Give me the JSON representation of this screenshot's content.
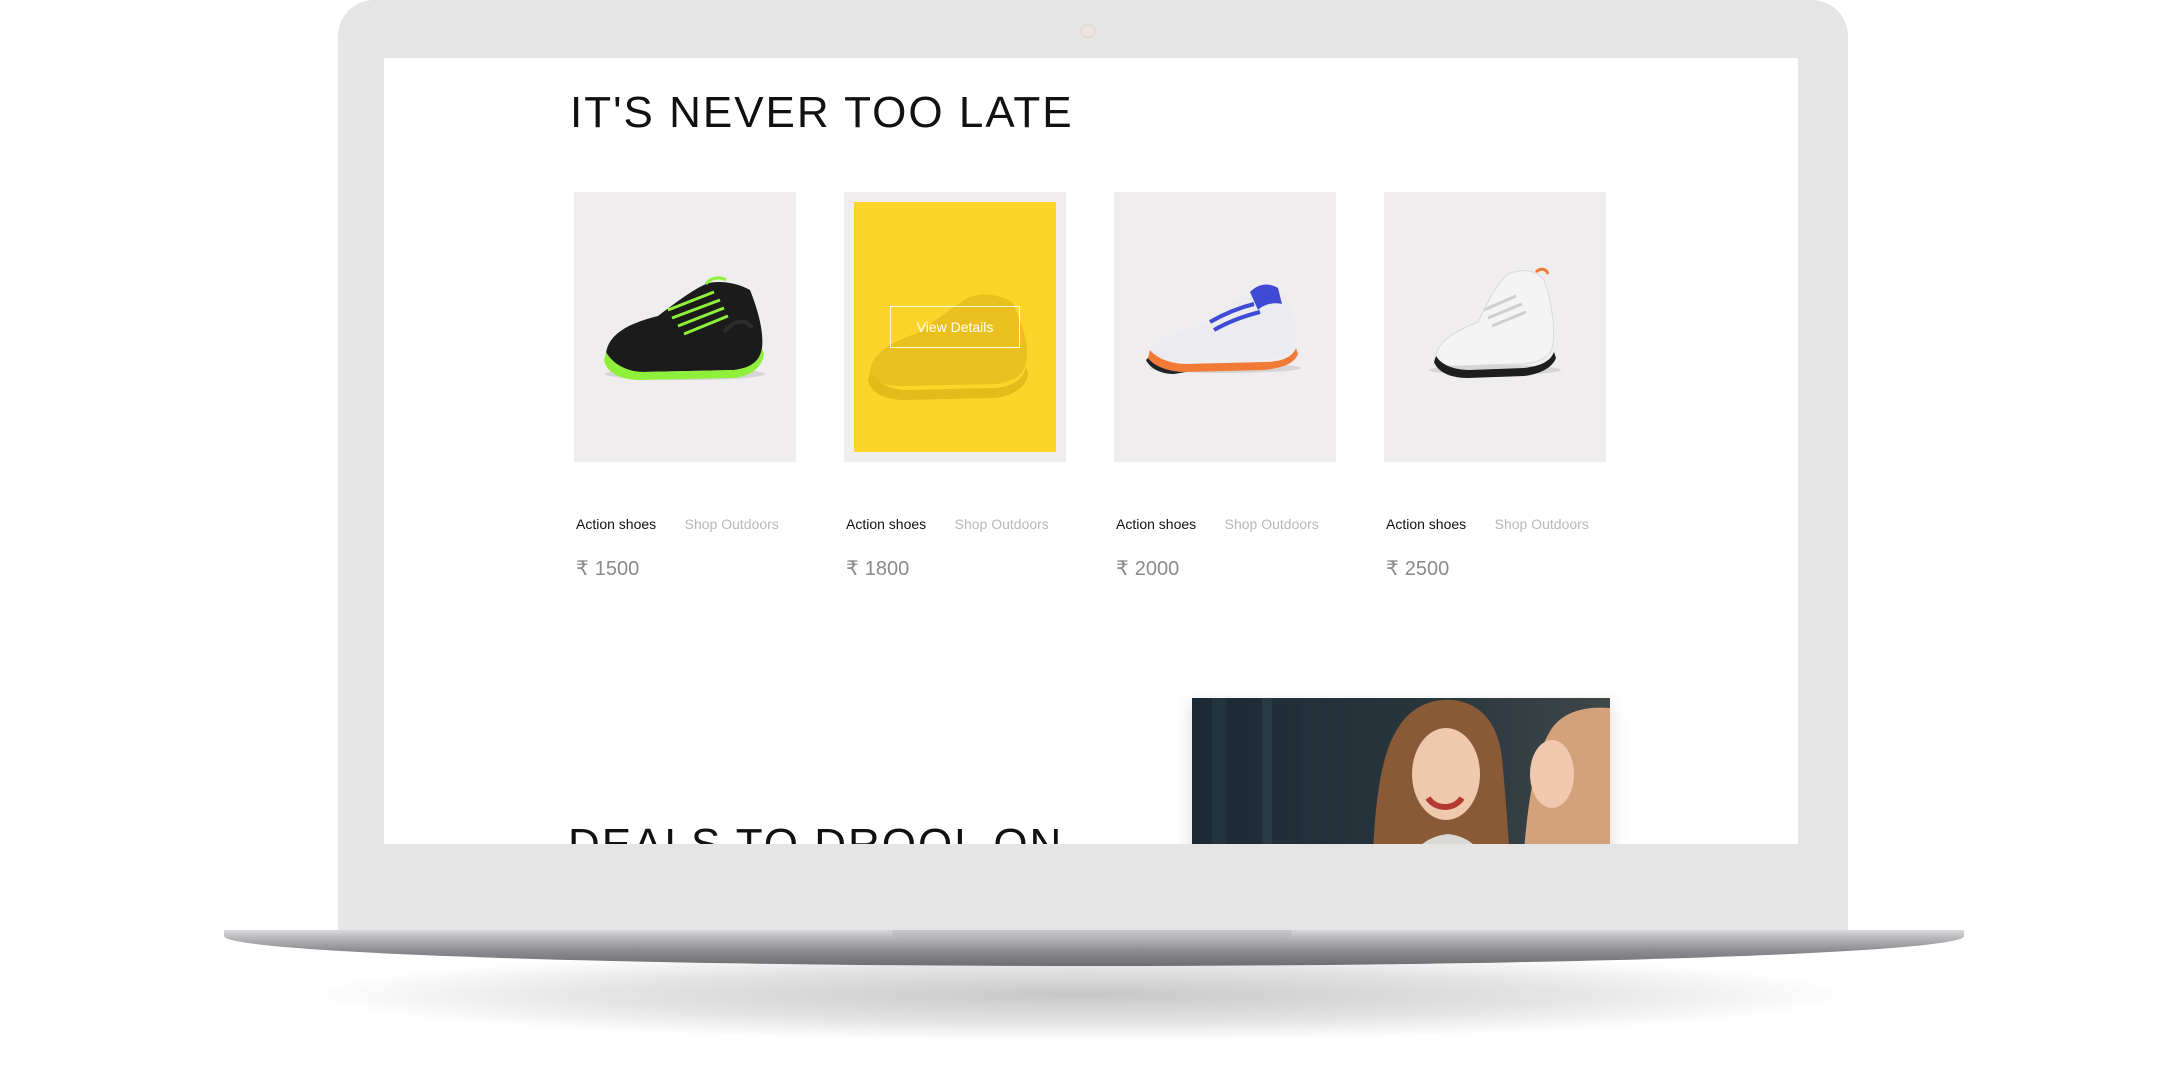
{
  "section": {
    "title": "IT'S NEVER TOO LATE"
  },
  "products": [
    {
      "name": "Action shoes",
      "category": "Shop Outdoors",
      "currency": "₹",
      "price": "1500"
    },
    {
      "name": "Action shoes",
      "category": "Shop Outdoors",
      "currency": "₹",
      "price": "1800",
      "overlay_button": "View Details"
    },
    {
      "name": "Action shoes",
      "category": "Shop Outdoors",
      "currency": "₹",
      "price": "2000"
    },
    {
      "name": "Action shoes",
      "category": "Shop Outdoors",
      "currency": "₹",
      "price": "2500"
    }
  ],
  "deals": {
    "title": "DEALS TO DROOL ON"
  },
  "colors": {
    "overlay_yellow": "#fcd42a",
    "card_bg": "#efeded",
    "device_frame": "#e5e5e5"
  }
}
